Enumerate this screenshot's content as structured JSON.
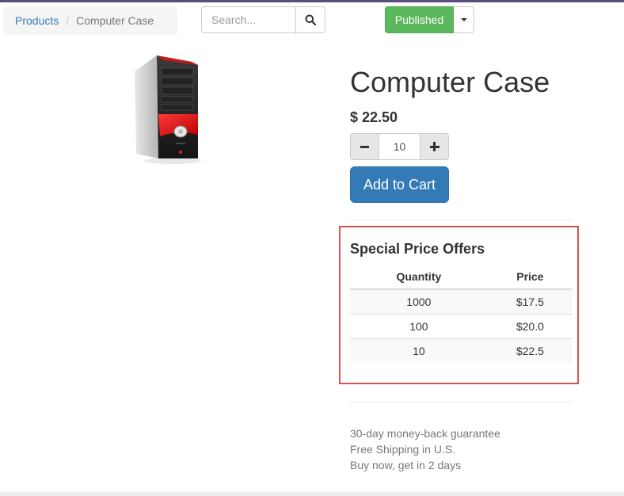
{
  "breadcrumb": {
    "parent": "Products",
    "separator": "/",
    "current": "Computer Case"
  },
  "search": {
    "placeholder": "Search...",
    "icon": "search-icon"
  },
  "publish": {
    "label": "Published",
    "color": "#5cb85c"
  },
  "product": {
    "image": "computer-case-tower",
    "title": "Computer Case",
    "price": "$ 22.50",
    "quantity": "10",
    "add_to_cart_label": "Add to Cart",
    "accent_color": "#337ab7"
  },
  "offers": {
    "title": "Special Price Offers",
    "headers": [
      "Quantity",
      "Price"
    ],
    "rows": [
      [
        "1000",
        "$17.5"
      ],
      [
        "100",
        "$20.0"
      ],
      [
        "10",
        "$22.5"
      ]
    ],
    "highlight_color": "#d9534f"
  },
  "features": [
    "30-day money-back guarantee",
    "Free Shipping in U.S.",
    "Buy now, get in 2 days"
  ]
}
